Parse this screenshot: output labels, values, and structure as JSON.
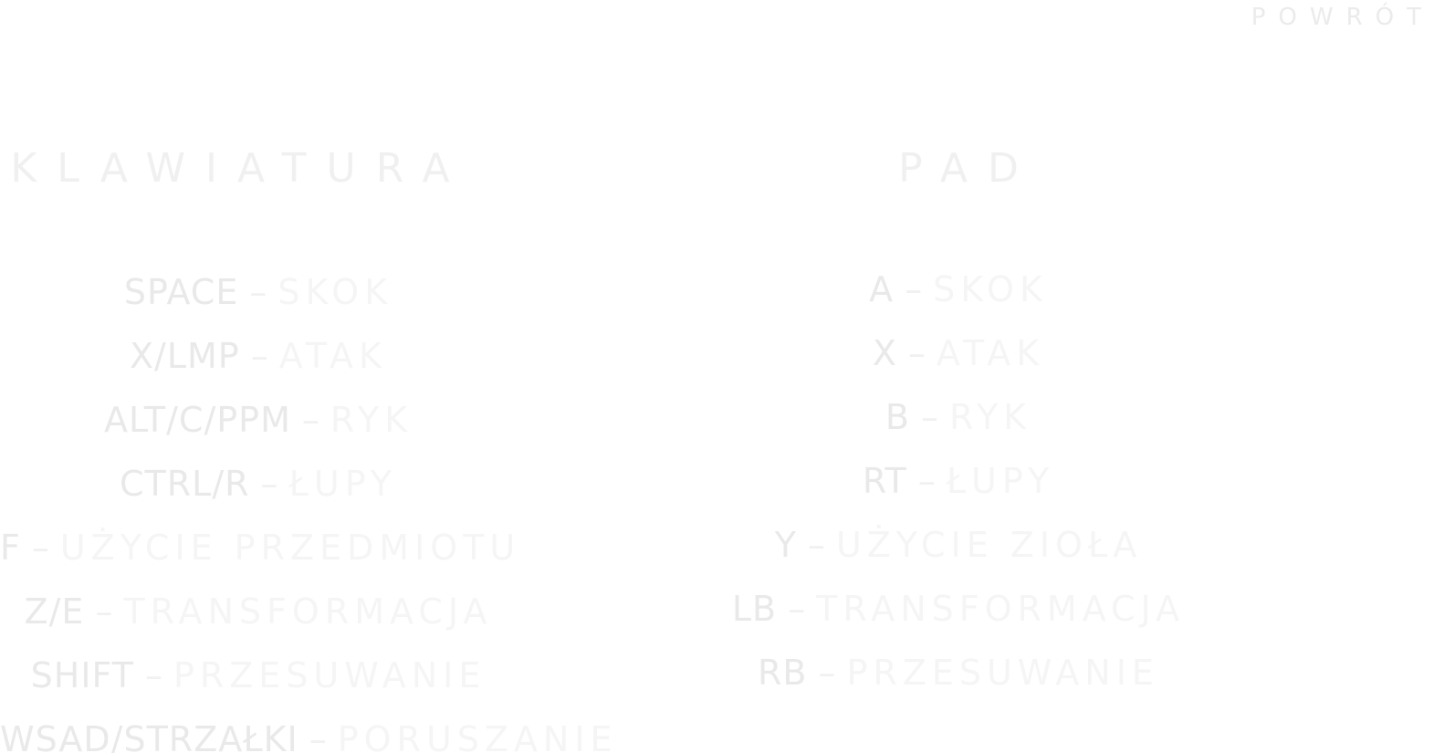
{
  "header": {
    "back_label": "POWRÓT"
  },
  "keyboard": {
    "title": "KLAWIATURA",
    "bindings": [
      {
        "key": "SPACE",
        "action": "SKOK"
      },
      {
        "key": "X/LMP",
        "action": "ATAK"
      },
      {
        "key": "ALT/C/PPM",
        "action": "RYK"
      },
      {
        "key": "CTRL/R",
        "action": "ŁUPY"
      },
      {
        "key": "F",
        "action": "UŻYCIE PRZEDMIOTU"
      },
      {
        "key": "Z/E",
        "action": "TRANSFORMACJA"
      },
      {
        "key": "SHIFT",
        "action": "PRZESUWANIE"
      },
      {
        "key": "WSAD/STRZAŁKI",
        "action": "PORUSZANIE"
      }
    ]
  },
  "pad": {
    "title": "PAD",
    "bindings": [
      {
        "key": "A",
        "action": "SKOK"
      },
      {
        "key": "X",
        "action": "ATAK"
      },
      {
        "key": "B",
        "action": "RYK"
      },
      {
        "key": "RT",
        "action": "ŁUPY"
      },
      {
        "key": "Y",
        "action": "UŻYCIE ZIOŁA"
      },
      {
        "key": "LB",
        "action": "TRANSFORMACJA"
      },
      {
        "key": "RB",
        "action": "PRZESUWANIE"
      }
    ]
  },
  "separator": "–"
}
